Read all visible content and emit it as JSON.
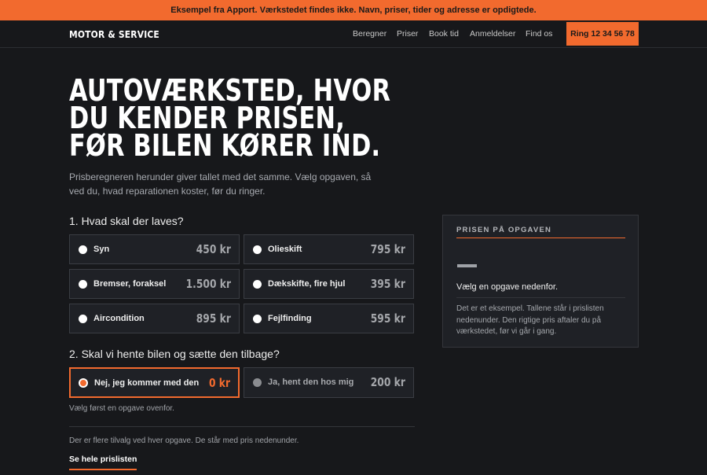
{
  "banner": {
    "text": "Eksempel fra Apport. Værkstedet findes ikke. Navn, priser, tider og adresse er opdigtede."
  },
  "header": {
    "brand": "MOTOR & SERVICE",
    "nav": [
      "Beregner",
      "Priser",
      "Book tid",
      "Anmeldelser",
      "Find os"
    ],
    "call_label": "Ring 12 34 56 78"
  },
  "hero": {
    "lines": [
      "AUTOVÆRKSTED, HVOR",
      "DU KENDER PRISEN,",
      "FØR BILEN KØRER IND."
    ],
    "lead": "Prisberegneren herunder giver tallet med det samme. Vælg opgaven, så ved du, hvad reparationen koster, før du ringer."
  },
  "step1": {
    "title": "1. Hvad skal der laves?",
    "options": [
      {
        "label": "Syn",
        "price": "450 kr"
      },
      {
        "label": "Olieskift",
        "price": "795 kr"
      },
      {
        "label": "Bremser, foraksel",
        "price": "1.500 kr"
      },
      {
        "label": "Dækskifte, fire hjul",
        "price": "395 kr"
      },
      {
        "label": "Aircondition",
        "price": "895 kr"
      },
      {
        "label": "Fejlfinding",
        "price": "595 kr"
      }
    ]
  },
  "step2": {
    "title": "2. Skal vi hente bilen og sætte den tilbage?",
    "options": [
      {
        "label": "Nej, jeg kommer med den",
        "price": "0 kr",
        "selected": true
      },
      {
        "label": "Ja, hent den hos mig",
        "price": "200 kr",
        "selected": false
      }
    ],
    "hint": "Vælg først en opgave ovenfor."
  },
  "footer": {
    "note": "Der er flere tilvalg ved hver opgave. De står med pris nedenunder.",
    "link": "Se hele prislisten"
  },
  "price_card": {
    "heading": "PRISEN PÅ OPGAVEN",
    "message": "Vælg en opgave nedenfor.",
    "note": "Det er et eksempel. Tallene står i prislisten nedenunder. Den rigtige pris aftaler du på værkstedet, før vi går i gang."
  },
  "colors": {
    "accent": "#f26a2e",
    "background": "#17181b",
    "surface": "#1f2126"
  }
}
